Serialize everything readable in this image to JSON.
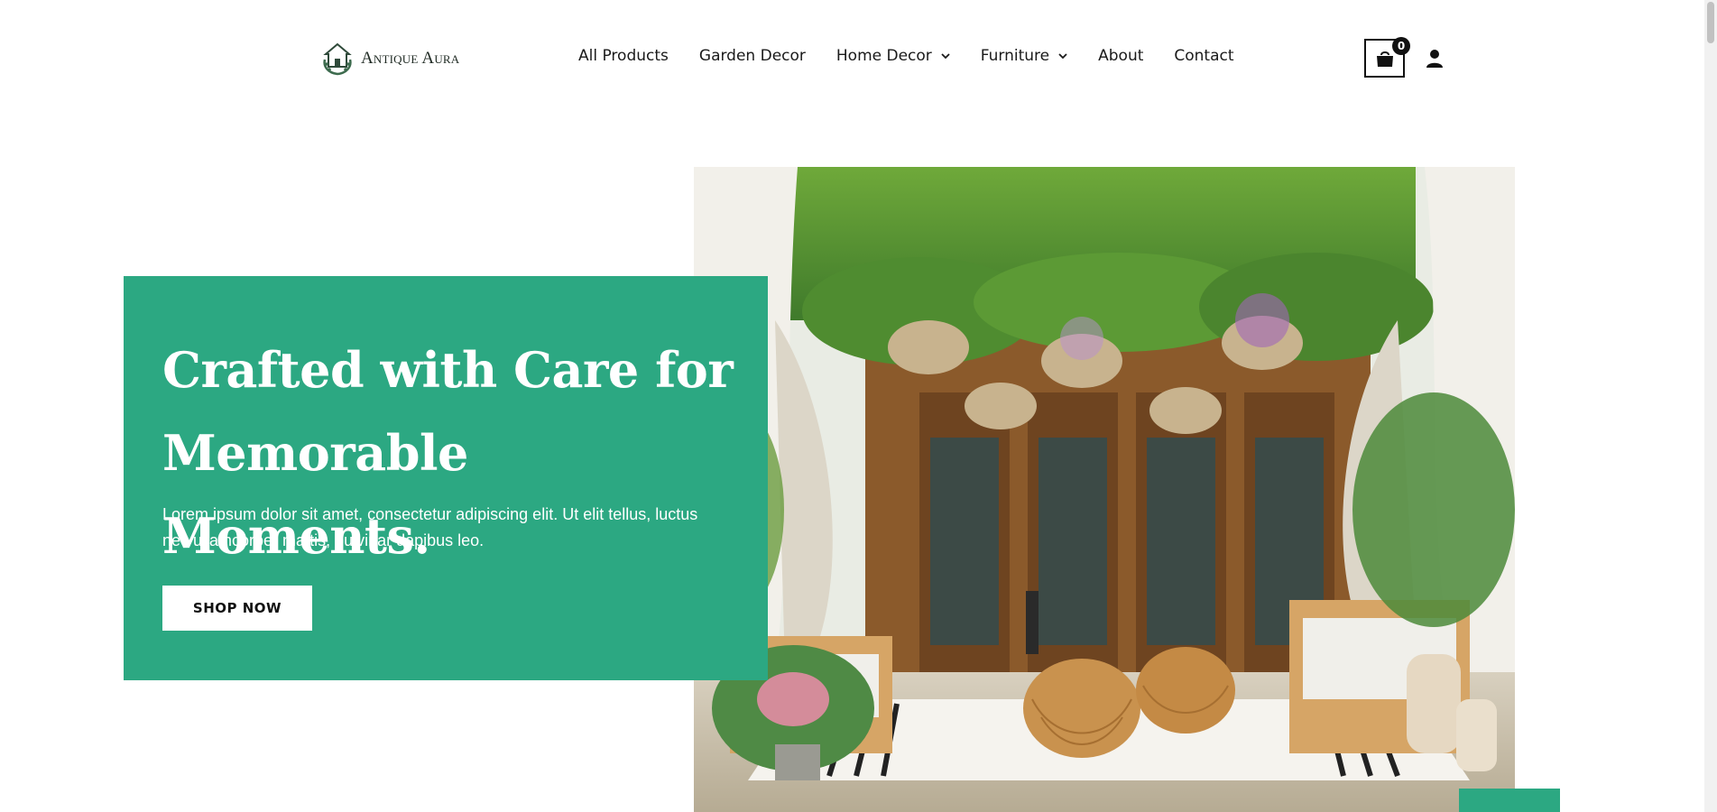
{
  "brand": {
    "name": "Antique Aura",
    "logo_icon": "house-wreath-icon"
  },
  "nav": {
    "items": [
      {
        "label": "All Products",
        "has_dropdown": false
      },
      {
        "label": "Garden Decor",
        "has_dropdown": false
      },
      {
        "label": "Home Decor",
        "has_dropdown": true
      },
      {
        "label": "Furniture",
        "has_dropdown": true
      },
      {
        "label": "About",
        "has_dropdown": false
      },
      {
        "label": "Contact",
        "has_dropdown": false
      }
    ]
  },
  "cart": {
    "count": "0",
    "icon": "shopping-bag-icon"
  },
  "account": {
    "icon": "user-icon"
  },
  "hero": {
    "title_line1": "Crafted with Care for",
    "title_line2": "Memorable Moments.",
    "text": "Lorem ipsum dolor sit amet, consectetur adipiscing elit. Ut elit tellus, luctus nec ullamcorper mattis, pulvinar dapibus leo.",
    "button_label": "SHOP NOW",
    "image_subject": "patio-with-hanging-plants-curtains-wicker-stools"
  },
  "colors": {
    "accent": "#2ca882",
    "text_dark": "#1a1a1a",
    "background": "#ffffff"
  }
}
